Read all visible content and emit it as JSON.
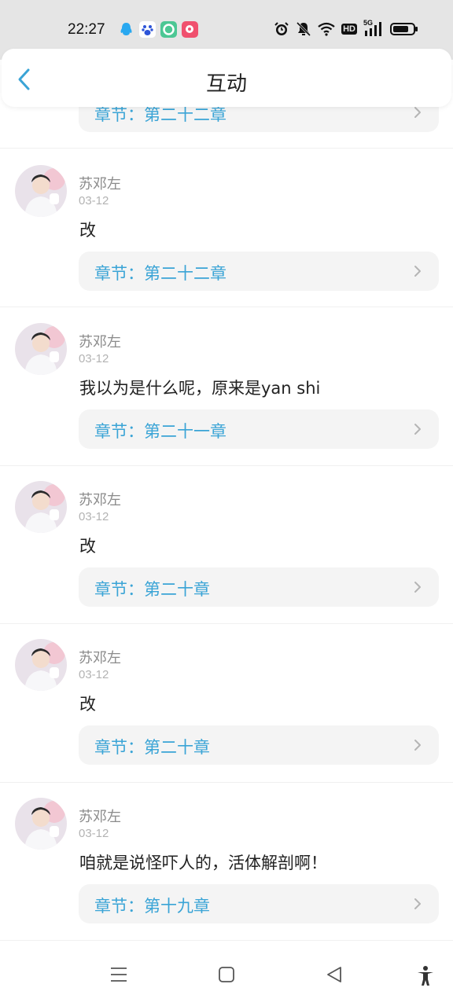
{
  "status_bar": {
    "time": "22:27",
    "network_label": "HD",
    "signal_label": "5G"
  },
  "nav": {
    "title": "互动",
    "back_icon": "chevron-left-icon"
  },
  "colors": {
    "accent": "#3aa4d6",
    "background": "#ffffff",
    "chapter_bg": "#f4f4f4"
  },
  "top_partial": {
    "chapter_label": "章节：第二十二章"
  },
  "comments": [
    {
      "user": "苏邓左",
      "date": "03-12",
      "text": "改",
      "chapter_label": "章节：第二十二章"
    },
    {
      "user": "苏邓左",
      "date": "03-12",
      "text": "我以为是什么呢，原来是yan shi",
      "chapter_label": "章节：第二十一章"
    },
    {
      "user": "苏邓左",
      "date": "03-12",
      "text": "改",
      "chapter_label": "章节：第二十章"
    },
    {
      "user": "苏邓左",
      "date": "03-12",
      "text": "改",
      "chapter_label": "章节：第二十章"
    },
    {
      "user": "苏邓左",
      "date": "03-12",
      "text": "咱就是说怪吓人的，活体解剖啊！",
      "chapter_label": "章节：第十九章"
    }
  ],
  "system_nav": [
    "menu-icon",
    "home-square-icon",
    "back-triangle-icon",
    "accessibility-icon"
  ]
}
